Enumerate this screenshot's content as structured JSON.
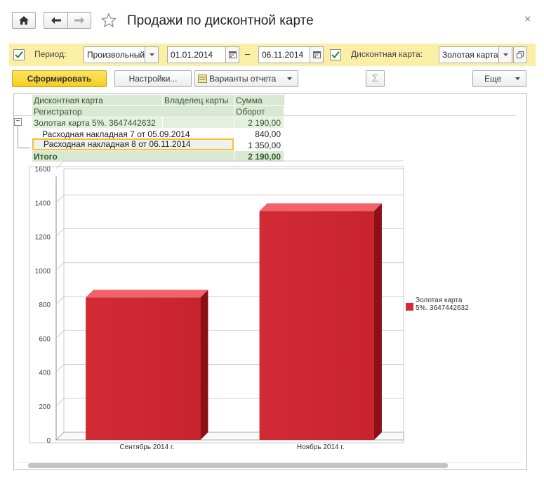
{
  "window": {
    "title": "Продажи по дисконтной карте",
    "close_glyph": "×"
  },
  "icons": {
    "home": "home-icon",
    "back": "arrow-left-icon",
    "forward": "arrow-right-icon",
    "favorite": "star-icon",
    "close": "close-icon"
  },
  "filters": {
    "period_label": "Период:",
    "period_type": "Произвольный",
    "date_from": "01.01.2014",
    "dash": "–",
    "date_to": "06.11.2014",
    "card_label": "Дисконтная карта:",
    "card_value": "Золотая карта"
  },
  "toolbar": {
    "generate": "Сформировать",
    "settings": "Настройки...",
    "variants": "Варианты отчета",
    "sigma": "Σ",
    "more": "Еще"
  },
  "report": {
    "headers": {
      "card": "Дисконтная карта",
      "owner": "Владелец карты",
      "sum": "Сумма",
      "registrar": "Регистратор",
      "turnover": "Оборот"
    },
    "group": {
      "label": "Золотая карта 5%. 3647442632",
      "value": "2 190,00"
    },
    "rows": [
      {
        "label": "Расходная накладная 7 от 05.09.2014",
        "value": "840,00"
      },
      {
        "label": "Расходная накладная 8 от 06.11.2014",
        "value": "1 350,00"
      }
    ],
    "total": {
      "label": "Итого",
      "value": "2 190,00"
    },
    "expand_glyph": "−"
  },
  "colors": {
    "accent_yellow": "#f5cd1f",
    "filter_bg": "#fbeea5",
    "header_green": "#d8e8d2",
    "bar_front": "#d22b35",
    "bar_top": "#f0636b",
    "bar_side": "#8f0f16"
  },
  "chart_data": {
    "type": "bar",
    "categories": [
      "Сентябрь 2014 г.",
      "Ноябрь 2014 г."
    ],
    "series": [
      {
        "name": "Золотая карта 5%. 3647442632",
        "values": [
          840,
          1350
        ]
      }
    ],
    "legend_lines": [
      "Золотая карта",
      "5%. 3647442632"
    ],
    "ylim": [
      0,
      1600
    ],
    "yticks": [
      0,
      200,
      400,
      600,
      800,
      1000,
      1200,
      1400,
      1600
    ],
    "grid": true,
    "legend_position": "right",
    "three_d": true
  }
}
